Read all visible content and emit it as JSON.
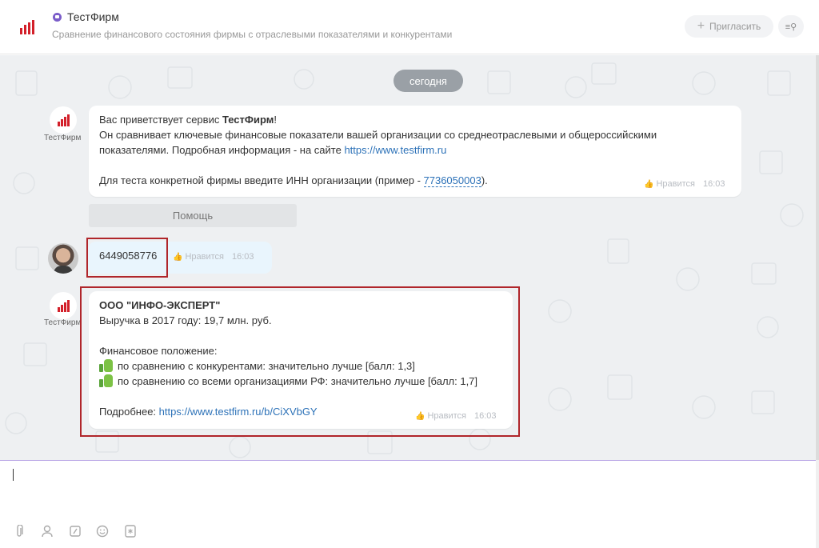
{
  "header": {
    "title": "ТестФирм",
    "subtitle": "Сравнение финансового состояния фирмы с отраслевыми показателями и конкурентами",
    "invite_label": "Пригласить"
  },
  "chat": {
    "date_label": "сегодня",
    "bot_name": "ТестФирм",
    "messages": [
      {
        "greeting_prefix": "Вас приветствует сервис ",
        "greeting_name": "ТестФирм",
        "greeting_suffix": "!",
        "line2": "Он сравнивает ключевые финансовые показатели вашей организации со среднеотраслевыми и общероссийскими",
        "line3_prefix": "показателями. Подробная информация - на сайте ",
        "site_link": "https://www.testfirm.ru",
        "line4_prefix": "Для теста конкретной фирмы введите ИНН организации (пример - ",
        "inn_example": "7736050003",
        "line4_suffix": ").",
        "like_label": "Нравится",
        "time": "16:03"
      },
      {
        "text": "6449058776",
        "like_label": "Нравится",
        "time": "16:03"
      },
      {
        "company": "ООО \"ИНФО-ЭКСПЕРТ\"",
        "revenue": "Выручка в 2017 году: 19,7 млн. руб.",
        "fin_title": "Финансовое положение:",
        "compare1": "по сравнению с конкурентами: значительно лучше [балл: 1,3]",
        "compare2": "по сравнению со всеми организациями РФ: значительно лучше [балл: 1,7]",
        "more_prefix": "Подробнее: ",
        "more_link": "https://www.testfirm.ru/b/CiXVbGY",
        "like_label": "Нравится",
        "time": "16:03"
      }
    ],
    "help_button": "Помощь"
  },
  "colors": {
    "brand_red": "#d3202a",
    "link": "#2d72b8",
    "highlight": "#b0262b",
    "thumb_green": "#7cc245"
  },
  "icons": [
    "logo-bars-icon",
    "chat-icon",
    "plus-icon",
    "search-list-icon",
    "thumbs-up-icon",
    "attach-icon",
    "user-icon",
    "command-icon",
    "emoji-icon",
    "snowflake-icon"
  ]
}
